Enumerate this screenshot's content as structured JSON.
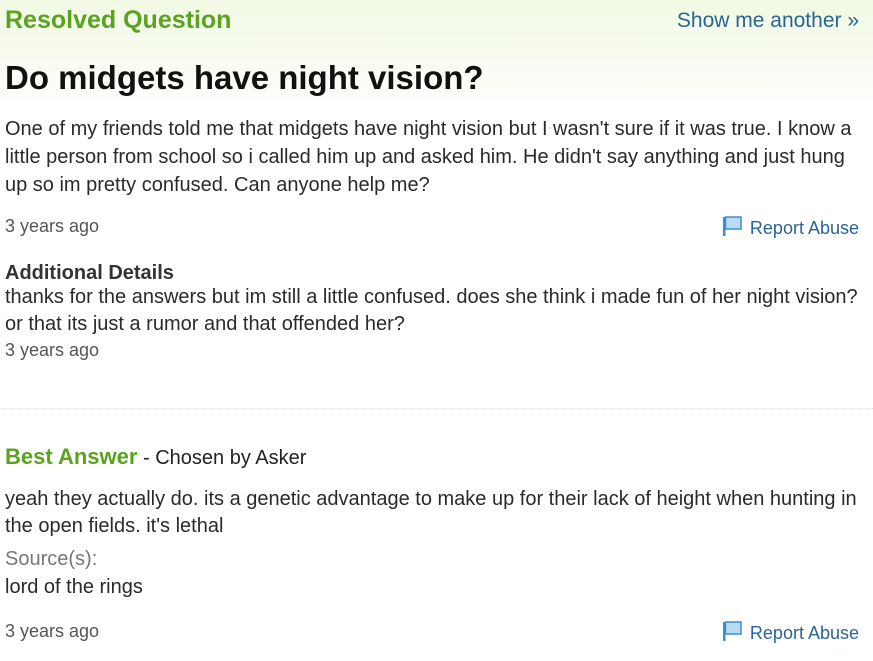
{
  "header": {
    "resolved_label": "Resolved Question",
    "show_another": "Show me another »"
  },
  "question": {
    "title": "Do midgets have night vision?",
    "body": "One of my friends told me that midgets have night vision but I wasn't sure if it was true. I know a little person from school so i called him up and asked him. He didn't say anything and just hung up so im pretty confused. Can anyone help me?",
    "timestamp": "3 years ago",
    "report_label": "Report Abuse"
  },
  "additional_details": {
    "heading": "Additional Details",
    "body": "thanks for the answers but im still a little confused. does she think i made fun of her night vision? or that its just a rumor and that offended her?",
    "timestamp": "3 years ago"
  },
  "best_answer": {
    "label": "Best Answer",
    "chosen_by": " - Chosen by Asker",
    "body": "yeah they actually do. its a genetic advantage to make up for their lack of height when hunting in the open fields. it's lethal",
    "sources_label": "Source(s):",
    "sources_text": "lord of the rings",
    "timestamp": "3 years ago",
    "report_label": "Report Abuse"
  },
  "icons": {
    "report": "flag-icon"
  },
  "colors": {
    "accent_green": "#5aa21f",
    "link_blue": "#2a6496",
    "flag_blue": "#4aa3df"
  }
}
